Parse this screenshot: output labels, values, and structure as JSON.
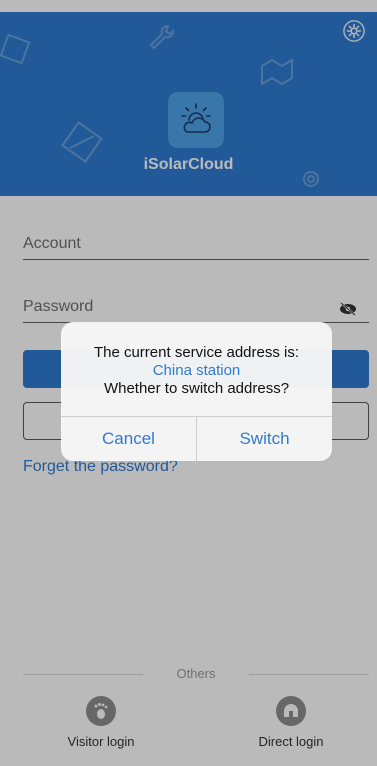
{
  "header": {
    "app_name": "iSolarCloud",
    "settings_icon": "gear-icon",
    "logo_icon": "sun-cloud-icon",
    "background_color": "#2f7bd1"
  },
  "login_form": {
    "account_placeholder": "Account",
    "password_placeholder": "Password",
    "password_toggle_icon": "eye-slash-icon",
    "forget_password": "Forget the password?"
  },
  "others": {
    "section_label": "Others",
    "visitor_login": {
      "label": "Visitor login",
      "icon": "footprint-icon"
    },
    "direct_login": {
      "label": "Direct login",
      "icon": "direct-login-icon"
    }
  },
  "dialog": {
    "title": "The current service address is:",
    "station": "China station",
    "question": "Whether to switch address?",
    "cancel_label": "Cancel",
    "switch_label": "Switch",
    "accent_color": "#2f7bd1"
  }
}
